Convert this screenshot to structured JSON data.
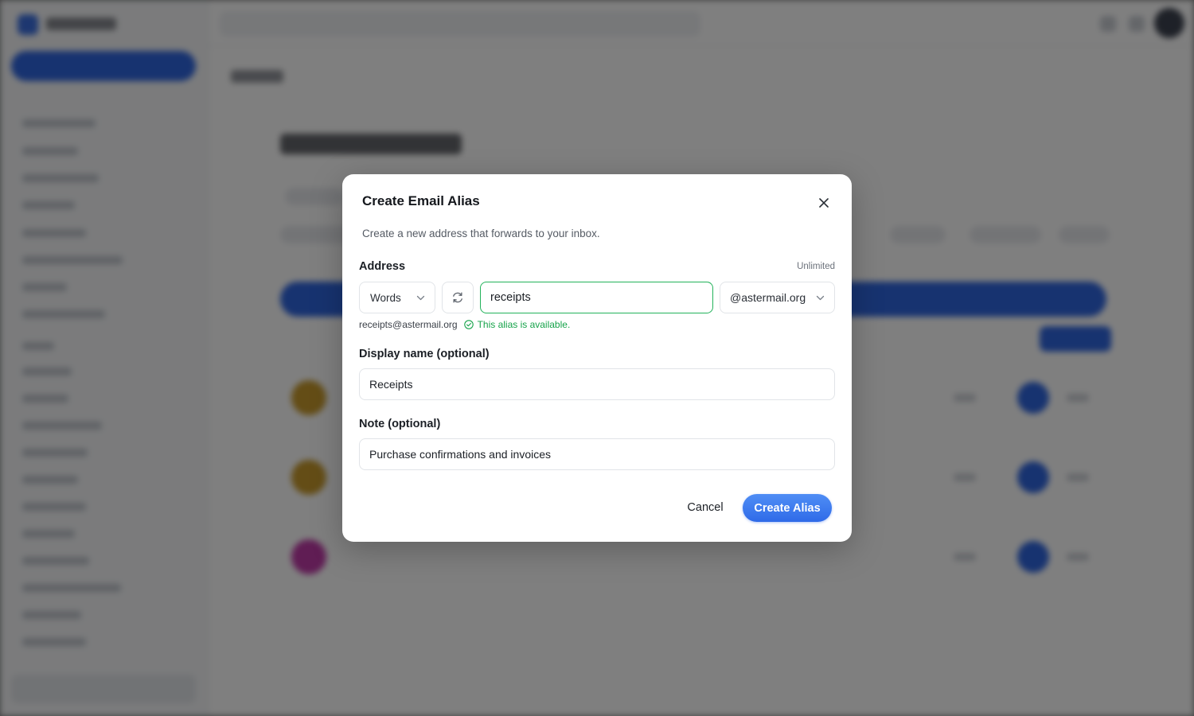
{
  "dialog": {
    "title": "Create Email Alias",
    "subtitle": "Create a new address that forwards to your inbox."
  },
  "address": {
    "label": "Address",
    "limit_text": "Unlimited",
    "generator_mode": "Words",
    "alias_value": "receipts",
    "domain": "@astermail.org",
    "preview": "receipts@astermail.org",
    "availability": "This alias is available."
  },
  "display_name": {
    "label": "Display name (optional)",
    "value": "Receipts"
  },
  "note": {
    "label": "Note (optional)",
    "value": "Purchase confirmations and invoices"
  },
  "actions": {
    "cancel": "Cancel",
    "create": "Create Alias"
  },
  "icons": {
    "close": "close-icon",
    "refresh": "refresh-icon",
    "chevron": "chevron-down-icon",
    "check": "check-circle-icon"
  },
  "colors": {
    "accent": "#2f6ae8",
    "success": "#16a34a",
    "success_border": "#22b25a"
  }
}
